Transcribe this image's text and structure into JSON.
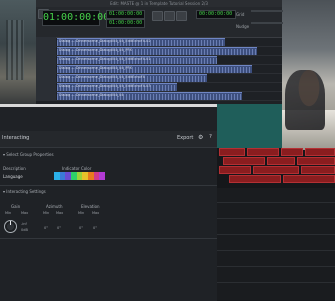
{
  "window_title": "Edit: MASTE @ 1 in Template Tutorial Session 2/3",
  "transport": {
    "main_counter": "01:00:00:00",
    "sub_counter_1": "01:00:00:00",
    "sub_counter_2": "01:00:00:00",
    "sub_counter_3": "00:00:00:00",
    "nudge_label": "Nudge",
    "grid_label": "Grid"
  },
  "tracks": [
    {
      "clip": "Dialog — Dinnerscene_Dialog004_04_EditEchoFX-02"
    },
    {
      "clip": "Dialog — Dinnerscene_Dialog004_04_PFX"
    },
    {
      "clip": "Dialog — Dinnerscene_Dialog004_04_EditEchoFX-01"
    },
    {
      "clip": "Dialog — Dinnerscene_Dialog004_04_PFX"
    },
    {
      "clip": "Dialog — Dinnerscene_Dialog004_04_EditEchoFX"
    },
    {
      "clip": "Dialog — Dinnerscene_Dialog004_04_EditEchoFX-03"
    },
    {
      "clip": "Dialog — Dinnerscene_Dialog004_04"
    }
  ],
  "dialog": {
    "title": "Interacting",
    "export_label": "Export",
    "section1_title": "Select Group Properties",
    "description_label": "Description",
    "description_value": "Language",
    "indicator_label": "Indicator Color",
    "colors": [
      "#2bb0e8",
      "#3a7ad6",
      "#6a4bd0",
      "#2ed06a",
      "#9ad23a",
      "#e8c22a",
      "#e87b1e",
      "#d13a8a",
      "#b23ad4"
    ],
    "section2_title": "Interacting Settings",
    "group_labels": {
      "gain": "Gain",
      "azimuth": "Azimuth",
      "elevation": "Elevation"
    },
    "min_label": "Min",
    "max_label": "Max",
    "gain_values": {
      "min": "-inf",
      "max": "0dB"
    },
    "azimuth_values": {
      "min": "0°",
      "max": "0°"
    },
    "elevation_values": {
      "min": "0°",
      "max": "0°"
    }
  }
}
